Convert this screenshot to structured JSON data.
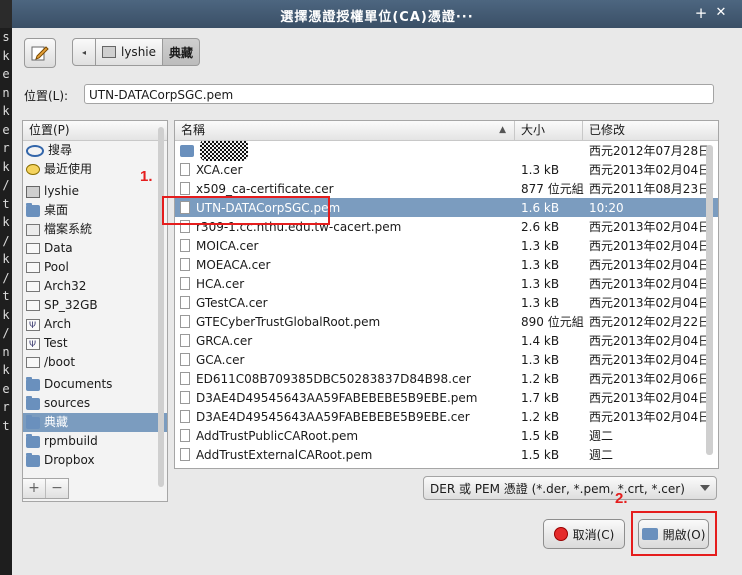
{
  "terminal": {
    "chars": [
      "s",
      "k",
      "e",
      "n",
      "k",
      "e",
      "r",
      "k",
      "/",
      "t",
      "k",
      "/",
      "k",
      "/",
      "t",
      "k",
      "/",
      "n",
      "k",
      "e",
      "r",
      "t"
    ]
  },
  "window": {
    "title": "選擇憑證授權單位(CA)憑證···",
    "add_label": "+",
    "close_label": "✕"
  },
  "breadcrumb": {
    "back_label": "◂",
    "home_label": "lyshie",
    "current_label": "典藏"
  },
  "location": {
    "label": "位置(L):",
    "value": "UTN-DATACorpSGC.pem"
  },
  "places": {
    "header": "位置(P)",
    "items": [
      {
        "label": "搜尋",
        "icon": "search-icon"
      },
      {
        "label": "最近使用",
        "icon": "recent-icon"
      },
      {
        "label": "lyshie",
        "icon": "home-icon"
      },
      {
        "label": "桌面",
        "icon": "folder-icon"
      },
      {
        "label": "檔案系統",
        "icon": "filesystem-icon"
      },
      {
        "label": "Data",
        "icon": "drive-icon"
      },
      {
        "label": "Pool",
        "icon": "drive-icon"
      },
      {
        "label": "Arch32",
        "icon": "drive-icon"
      },
      {
        "label": "SP_32GB",
        "icon": "drive-icon"
      },
      {
        "label": "Arch",
        "icon": "usb-icon"
      },
      {
        "label": "Test",
        "icon": "usb-icon"
      },
      {
        "label": "/boot",
        "icon": "drive-icon"
      },
      {
        "label": "Documents",
        "icon": "folder-icon"
      },
      {
        "label": "sources",
        "icon": "folder-icon"
      },
      {
        "label": "典藏",
        "icon": "folder-icon"
      },
      {
        "label": "rpmbuild",
        "icon": "folder-icon"
      },
      {
        "label": "Dropbox",
        "icon": "folder-icon"
      }
    ],
    "add_label": "+",
    "remove_label": "−"
  },
  "files": {
    "columns": {
      "name": "名稱",
      "size": "大小",
      "modified": "已修改"
    },
    "rows": [
      {
        "name": "",
        "size": "",
        "modified": "西元2012年07月28日",
        "type": "folder"
      },
      {
        "name": "XCA.cer",
        "size": "1.3 kB",
        "modified": "西元2013年02月04日",
        "type": "file"
      },
      {
        "name": "x509_ca-certificate.cer",
        "size": "877 位元組",
        "modified": "西元2011年08月23日",
        "type": "file"
      },
      {
        "name": "UTN-DATACorpSGC.pem",
        "size": "1.6 kB",
        "modified": "10:20",
        "type": "file",
        "selected": true
      },
      {
        "name": "r309-1.cc.nthu.edu.tw-cacert.pem",
        "size": "2.6 kB",
        "modified": "西元2013年02月04日",
        "type": "file"
      },
      {
        "name": "MOICA.cer",
        "size": "1.3 kB",
        "modified": "西元2013年02月04日",
        "type": "file"
      },
      {
        "name": "MOEACA.cer",
        "size": "1.3 kB",
        "modified": "西元2013年02月04日",
        "type": "file"
      },
      {
        "name": "HCA.cer",
        "size": "1.3 kB",
        "modified": "西元2013年02月04日",
        "type": "file"
      },
      {
        "name": "GTestCA.cer",
        "size": "1.3 kB",
        "modified": "西元2013年02月04日",
        "type": "file"
      },
      {
        "name": "GTECyberTrustGlobalRoot.pem",
        "size": "890 位元組",
        "modified": "西元2012年02月22日",
        "type": "file"
      },
      {
        "name": "GRCA.cer",
        "size": "1.4 kB",
        "modified": "西元2013年02月04日",
        "type": "file"
      },
      {
        "name": "GCA.cer",
        "size": "1.3 kB",
        "modified": "西元2013年02月04日",
        "type": "file"
      },
      {
        "name": "ED611C08B709385DBC50283837D84B98.cer",
        "size": "1.2 kB",
        "modified": "西元2013年02月06日",
        "type": "file"
      },
      {
        "name": "D3AE4D49545643AA59FABEBEBE5B9EBE.pem",
        "size": "1.7 kB",
        "modified": "西元2013年02月04日",
        "type": "file"
      },
      {
        "name": "D3AE4D49545643AA59FABEBEBE5B9EBE.cer",
        "size": "1.2 kB",
        "modified": "西元2013年02月04日",
        "type": "file"
      },
      {
        "name": "AddTrustPublicCARoot.pem",
        "size": "1.5 kB",
        "modified": "週二",
        "type": "file"
      },
      {
        "name": "AddTrustExternalCARoot.pem",
        "size": "1.5 kB",
        "modified": "週二",
        "type": "file"
      }
    ]
  },
  "filter": {
    "value": "DER 或 PEM 憑證 (*.der, *.pem, *.crt, *.cer)"
  },
  "buttons": {
    "cancel_label": "取消(C)",
    "open_label": "開啟(O)"
  },
  "annotations": {
    "step1_label": "1.",
    "step2_label": "2.",
    "color": "#e51d1d"
  },
  "colors": {
    "selection": "#7b9cbf",
    "titlebar": "#3f556c"
  }
}
